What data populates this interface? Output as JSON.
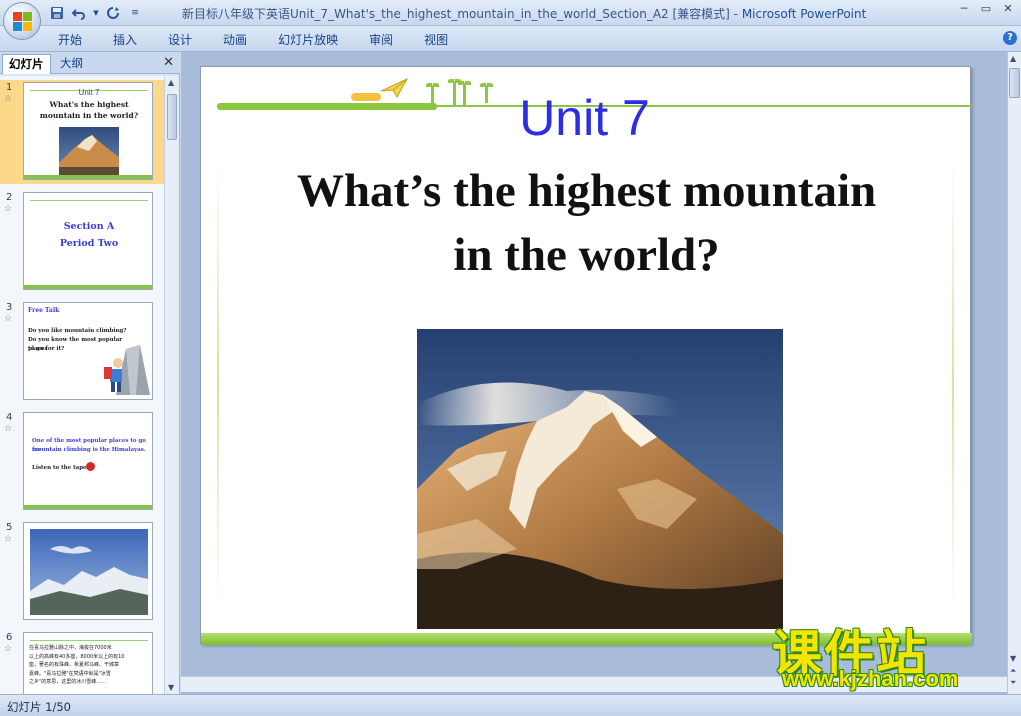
{
  "window": {
    "title": "新目标八年级下英语Unit_7_What's_the_highest_mountain_in_the_world_Section_A2 [兼容模式]",
    "separator": " - ",
    "app_name": "Microsoft PowerPoint"
  },
  "quick_access": {
    "save_icon": "save-icon",
    "undo_icon": "undo-icon",
    "redo_icon": "redo-icon",
    "customize_icon": "chevron-down-icon"
  },
  "ribbon": {
    "tabs": [
      "开始",
      "插入",
      "设计",
      "动画",
      "幻灯片放映",
      "审阅",
      "视图"
    ]
  },
  "left_pane": {
    "tab_slides": "幻灯片",
    "tab_outline": "大纲",
    "thumbnails": [
      {
        "num": "1",
        "title": "Unit 7",
        "subtitle": "What's the highest   mountain in the world?"
      },
      {
        "num": "2",
        "title": "Section A",
        "subtitle": "Period Two"
      },
      {
        "num": "3",
        "title": "Free Talk",
        "lines": [
          "Do you like mountain  climbing?",
          "Do you know  the most popular  places",
          "to go for it?"
        ]
      },
      {
        "num": "4",
        "lines": [
          "One of the most popular  places to go for",
          "mountain climbing is the Himalayas.",
          "Listen to the tape."
        ]
      },
      {
        "num": "5"
      },
      {
        "num": "6",
        "lines": [
          "在喜马拉雅山脉之中，海拔在7000米",
          "以上的高峰有40多座，8000米以上的有10",
          "座，著名的有珠峰、希夏邦马峰、干城章",
          "嘉峰。\"喜马拉雅\"在梵语中就是\"冰雪",
          "之乡\"的意思，这里的冰川雪峰……"
        ]
      }
    ]
  },
  "slide": {
    "unit": "Unit 7",
    "title_line1": "What’s the highest mountain",
    "title_line2": "in the world?"
  },
  "status": {
    "slide_indicator": "幻灯片 1/50"
  },
  "watermark": {
    "cn": "课件站",
    "url": "www.kjzhan.com"
  },
  "colors": {
    "accent_green": "#8dc63f",
    "unit_blue": "#2d2de6",
    "selection": "#fbd88a"
  }
}
